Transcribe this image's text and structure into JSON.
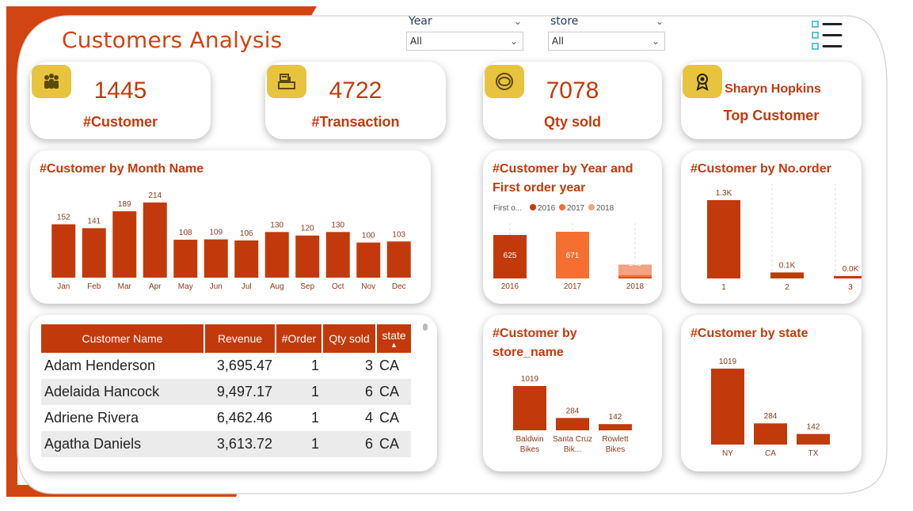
{
  "header": {
    "title": "Customers Analysis"
  },
  "slicers": {
    "year": {
      "label": "Year",
      "value": "All"
    },
    "store": {
      "label": "store",
      "value": "All"
    }
  },
  "colors": {
    "accent": "#C23A0B",
    "accent_light": "#F46F30",
    "accent_lighter": "#F4A284",
    "badge": "#E8C33E"
  },
  "kpis": {
    "customers": {
      "value": "1445",
      "label": "#Customer",
      "icon": "people-icon"
    },
    "transactions": {
      "value": "4722",
      "label": "#Transaction",
      "icon": "register-icon"
    },
    "qty": {
      "value": "7078",
      "label": "Qty sold",
      "icon": "sold-icon"
    },
    "top": {
      "value": "Sharyn Hopkins",
      "label": "Top Customer",
      "icon": "award-icon"
    }
  },
  "chart_data": [
    {
      "id": "by_month",
      "type": "bar",
      "title": "#Customer by Month Name",
      "categories": [
        "Jan",
        "Feb",
        "Mar",
        "Apr",
        "May",
        "Jun",
        "Jul",
        "Aug",
        "Sep",
        "Oct",
        "Nov",
        "Dec"
      ],
      "values": [
        152,
        141,
        189,
        214,
        108,
        109,
        106,
        130,
        120,
        130,
        100,
        103
      ],
      "data_labels": [
        "152",
        "141",
        "189",
        "214",
        "108",
        "109",
        "106",
        "130",
        "120",
        "130",
        "100",
        "103"
      ],
      "ylim": [
        0,
        214
      ]
    },
    {
      "id": "by_year",
      "type": "bar",
      "title": "#Customer by Year and First order year",
      "legend": {
        "title": "First o...",
        "entries": [
          "2016",
          "2017",
          "2018"
        ]
      },
      "categories": [
        "2016",
        "2017",
        "2018"
      ],
      "series": [
        {
          "name": "2016",
          "values": [
            625,
            0,
            20
          ]
        },
        {
          "name": "2017",
          "values": [
            0,
            671,
            30
          ]
        },
        {
          "name": "2018",
          "values": [
            0,
            0,
            149
          ]
        }
      ],
      "data_labels": [
        "625",
        "671",
        "149"
      ],
      "ylim": [
        0,
        671
      ]
    },
    {
      "id": "by_order",
      "type": "bar",
      "title": "#Customer by No.order",
      "categories": [
        "1",
        "2",
        "3"
      ],
      "values": [
        1300,
        100,
        40
      ],
      "data_labels": [
        "1.3K",
        "0.1K",
        "0.0K"
      ],
      "ylim": [
        0,
        1300
      ]
    },
    {
      "id": "by_store",
      "type": "bar",
      "title": "#Customer by store_name",
      "categories": [
        "Baldwin Bikes",
        "Santa Cruz Bik...",
        "Rowlett Bikes"
      ],
      "values": [
        1019,
        284,
        142
      ],
      "data_labels": [
        "1019",
        "284",
        "142"
      ],
      "ylim": [
        0,
        1019
      ]
    },
    {
      "id": "by_state",
      "type": "bar",
      "title": "#Customer by state",
      "categories": [
        "NY",
        "CA",
        "TX"
      ],
      "values": [
        1019,
        284,
        142
      ],
      "data_labels": [
        "1019",
        "284",
        "142"
      ],
      "ylim": [
        0,
        1019
      ]
    }
  ],
  "table": {
    "columns": [
      "Customer Name",
      "Revenue",
      "#Order",
      "Qty sold",
      "state"
    ],
    "rows": [
      [
        "Adam Henderson",
        "3,695.47",
        "1",
        "3",
        "CA"
      ],
      [
        "Adelaida Hancock",
        "9,497.17",
        "1",
        "6",
        "CA"
      ],
      [
        "Adriene Rivera",
        "6,462.46",
        "1",
        "4",
        "CA"
      ],
      [
        "Agatha Daniels",
        "3,613.72",
        "1",
        "6",
        "CA"
      ]
    ]
  }
}
